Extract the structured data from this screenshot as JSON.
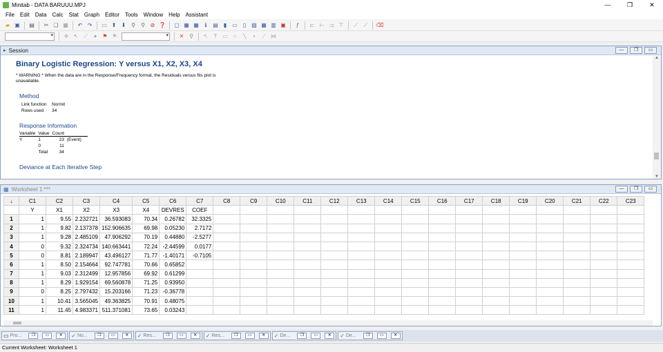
{
  "window": {
    "title": "Minitab - DATA BARUUU.MPJ"
  },
  "menu": [
    "File",
    "Edit",
    "Data",
    "Calc",
    "Stat",
    "Graph",
    "Editor",
    "Tools",
    "Window",
    "Help",
    "Assistant"
  ],
  "session": {
    "title": "Session",
    "heading": "Binary Logistic Regression: Y versus X1, X2, X3, X4",
    "warning": "* WARNING * When the data are in the Response/Frequency format, the Residuals versus fits plot is unavailable.",
    "method": {
      "heading": "Method",
      "rows": [
        {
          "label": "Link function",
          "value": "Normit"
        },
        {
          "label": "Rows used",
          "value": "34"
        }
      ]
    },
    "response": {
      "heading": "Response Information",
      "headers": [
        "Variable",
        "Value",
        "Count",
        ""
      ],
      "rows": [
        [
          "Y",
          "1",
          "23",
          "(Event)"
        ],
        [
          "",
          "0",
          "11",
          ""
        ],
        [
          "",
          "Total",
          "34",
          ""
        ]
      ]
    },
    "next_heading": "Deviance at Each Iterative Step"
  },
  "worksheet": {
    "title": "Worksheet 1 ***",
    "corner": "↓",
    "columns": [
      "C1",
      "C2",
      "C3",
      "C4",
      "C5",
      "C6",
      "C7",
      "C8",
      "C9",
      "C10",
      "C11",
      "C12",
      "C13",
      "C14",
      "C15",
      "C16",
      "C17",
      "C18",
      "C19",
      "C20",
      "C21",
      "C22",
      "C23"
    ],
    "names": [
      "Y",
      "X1",
      "X2",
      "X3",
      "X4",
      "DEVRES",
      "COEF",
      "",
      "",
      "",
      "",
      "",
      "",
      "",
      "",
      "",
      "",
      "",
      "",
      "",
      "",
      "",
      ""
    ],
    "rows": [
      [
        "1",
        "1",
        "9.55",
        "2.232721",
        "36.593083",
        "70.34",
        "0.26782",
        "32.3325"
      ],
      [
        "2",
        "1",
        "9.82",
        "2.137378",
        "152.906635",
        "69.98",
        "0.05230",
        "2.7172"
      ],
      [
        "3",
        "1",
        "9.28",
        "2.485109",
        "47.906292",
        "70.19",
        "0.44880",
        "-2.5277"
      ],
      [
        "4",
        "0",
        "9.32",
        "2.324734",
        "140.663441",
        "72.24",
        "-2.44599",
        "0.0177"
      ],
      [
        "5",
        "0",
        "8.81",
        "2.189947",
        "43.496127",
        "71.77",
        "-1.40171",
        "-0.7105"
      ],
      [
        "6",
        "1",
        "8.50",
        "2.154664",
        "92.747781",
        "70.66",
        "0.65852",
        ""
      ],
      [
        "7",
        "1",
        "9.03",
        "2.312499",
        "12.957856",
        "69.92",
        "0.61299",
        ""
      ],
      [
        "8",
        "1",
        "8.29",
        "1.929154",
        "69.560878",
        "71.25",
        "0.93950",
        ""
      ],
      [
        "9",
        "0",
        "8.25",
        "2.797432",
        "15.203166",
        "71.23",
        "-0.36778",
        ""
      ],
      [
        "10",
        "1",
        "10.41",
        "3.565045",
        "49.363825",
        "70.91",
        "0.48075",
        ""
      ],
      [
        "11",
        "1",
        "11.45",
        "4.983371",
        "511.371081",
        "73.65",
        "0.03243",
        ""
      ]
    ]
  },
  "taskbar": [
    "Pro...",
    "No...",
    "Res...",
    "Res...",
    "De...",
    "De..."
  ],
  "status": {
    "text": "Current Worksheet: Worksheet 1"
  }
}
